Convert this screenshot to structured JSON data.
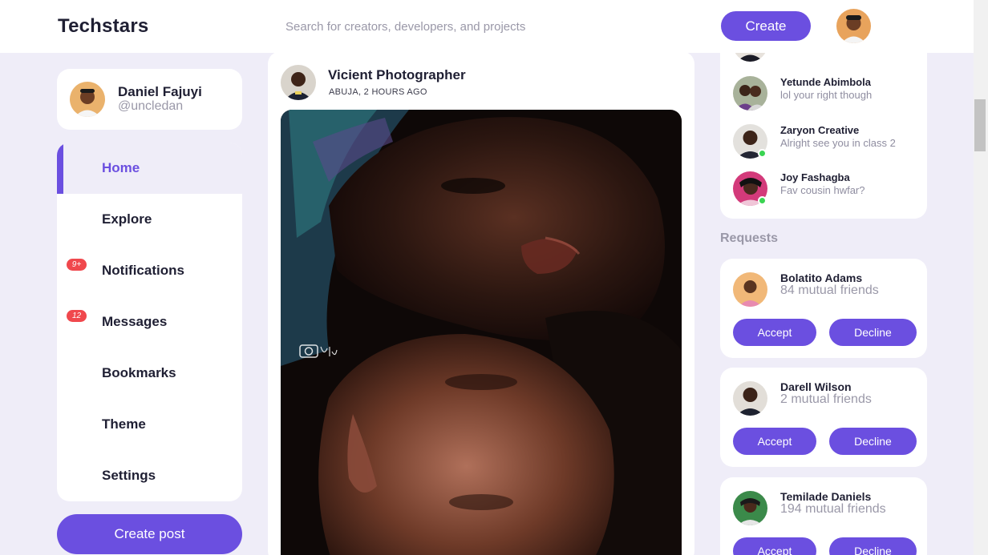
{
  "header": {
    "logo": "Techstars",
    "search_placeholder": "Search for creators, developers, and projects",
    "create_label": "Create"
  },
  "profile": {
    "name": "Daniel Fajuyi",
    "handle": "@uncledan"
  },
  "menu": {
    "items": [
      {
        "label": "Home",
        "active": true
      },
      {
        "label": "Explore"
      },
      {
        "label": "Notifications",
        "badge": "9+"
      },
      {
        "label": "Messages",
        "badge": "12"
      },
      {
        "label": "Bookmarks"
      },
      {
        "label": "Theme"
      },
      {
        "label": "Settings"
      }
    ]
  },
  "create_post_label": "Create post",
  "feed": {
    "author": "Vicient Photographer",
    "meta": "ABUJA, 2 HOURS AGO"
  },
  "messages": [
    {
      "name": "Yetunde Abimbola",
      "text": "lol your right though",
      "online": false
    },
    {
      "name": "Zaryon Creative",
      "text": "Alright see you in class 2",
      "online": true
    },
    {
      "name": "Joy Fashagba",
      "text": "Fav cousin hwfar?",
      "online": true
    }
  ],
  "requests": {
    "title": "Requests",
    "accept_label": "Accept",
    "decline_label": "Decline",
    "items": [
      {
        "name": "Bolatito Adams",
        "mutual": "84 mutual friends"
      },
      {
        "name": "Darell Wilson",
        "mutual": "2 mutual friends"
      },
      {
        "name": "Temilade Daniels",
        "mutual": "194 mutual friends"
      }
    ]
  },
  "colors": {
    "accent": "#6b4fe0",
    "background": "#efedf8",
    "badge": "#f0484d",
    "online": "#3ad452"
  }
}
